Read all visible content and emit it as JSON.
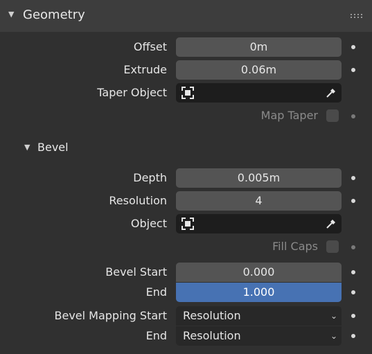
{
  "geometry": {
    "title": "Geometry",
    "offset": {
      "label": "Offset",
      "value": "0m"
    },
    "extrude": {
      "label": "Extrude",
      "value": "0.06m"
    },
    "taper_object": {
      "label": "Taper Object",
      "value": ""
    },
    "map_taper": {
      "label": "Map Taper",
      "checked": false
    }
  },
  "bevel": {
    "title": "Bevel",
    "depth": {
      "label": "Depth",
      "value": "0.005m"
    },
    "resolution": {
      "label": "Resolution",
      "value": "4"
    },
    "object": {
      "label": "Object",
      "value": ""
    },
    "fill_caps": {
      "label": "Fill Caps",
      "checked": false
    },
    "bevel_start": {
      "label": "Bevel Start",
      "value": "0.000"
    },
    "end": {
      "label": "End",
      "value": "1.000"
    },
    "mapping_start": {
      "label": "Bevel Mapping Start",
      "value": "Resolution"
    },
    "mapping_end": {
      "label": "End",
      "value": "Resolution"
    }
  },
  "colors": {
    "panel_bg": "#303030",
    "header_bg": "#3d3d3d",
    "field_bg": "#545454",
    "accent_blue": "#4772b3",
    "dark_field": "#1d1d1d"
  },
  "icons": [
    "chevron-down-icon",
    "drag-grip-icon",
    "object-icon",
    "eyedropper-icon",
    "dot-icon"
  ]
}
